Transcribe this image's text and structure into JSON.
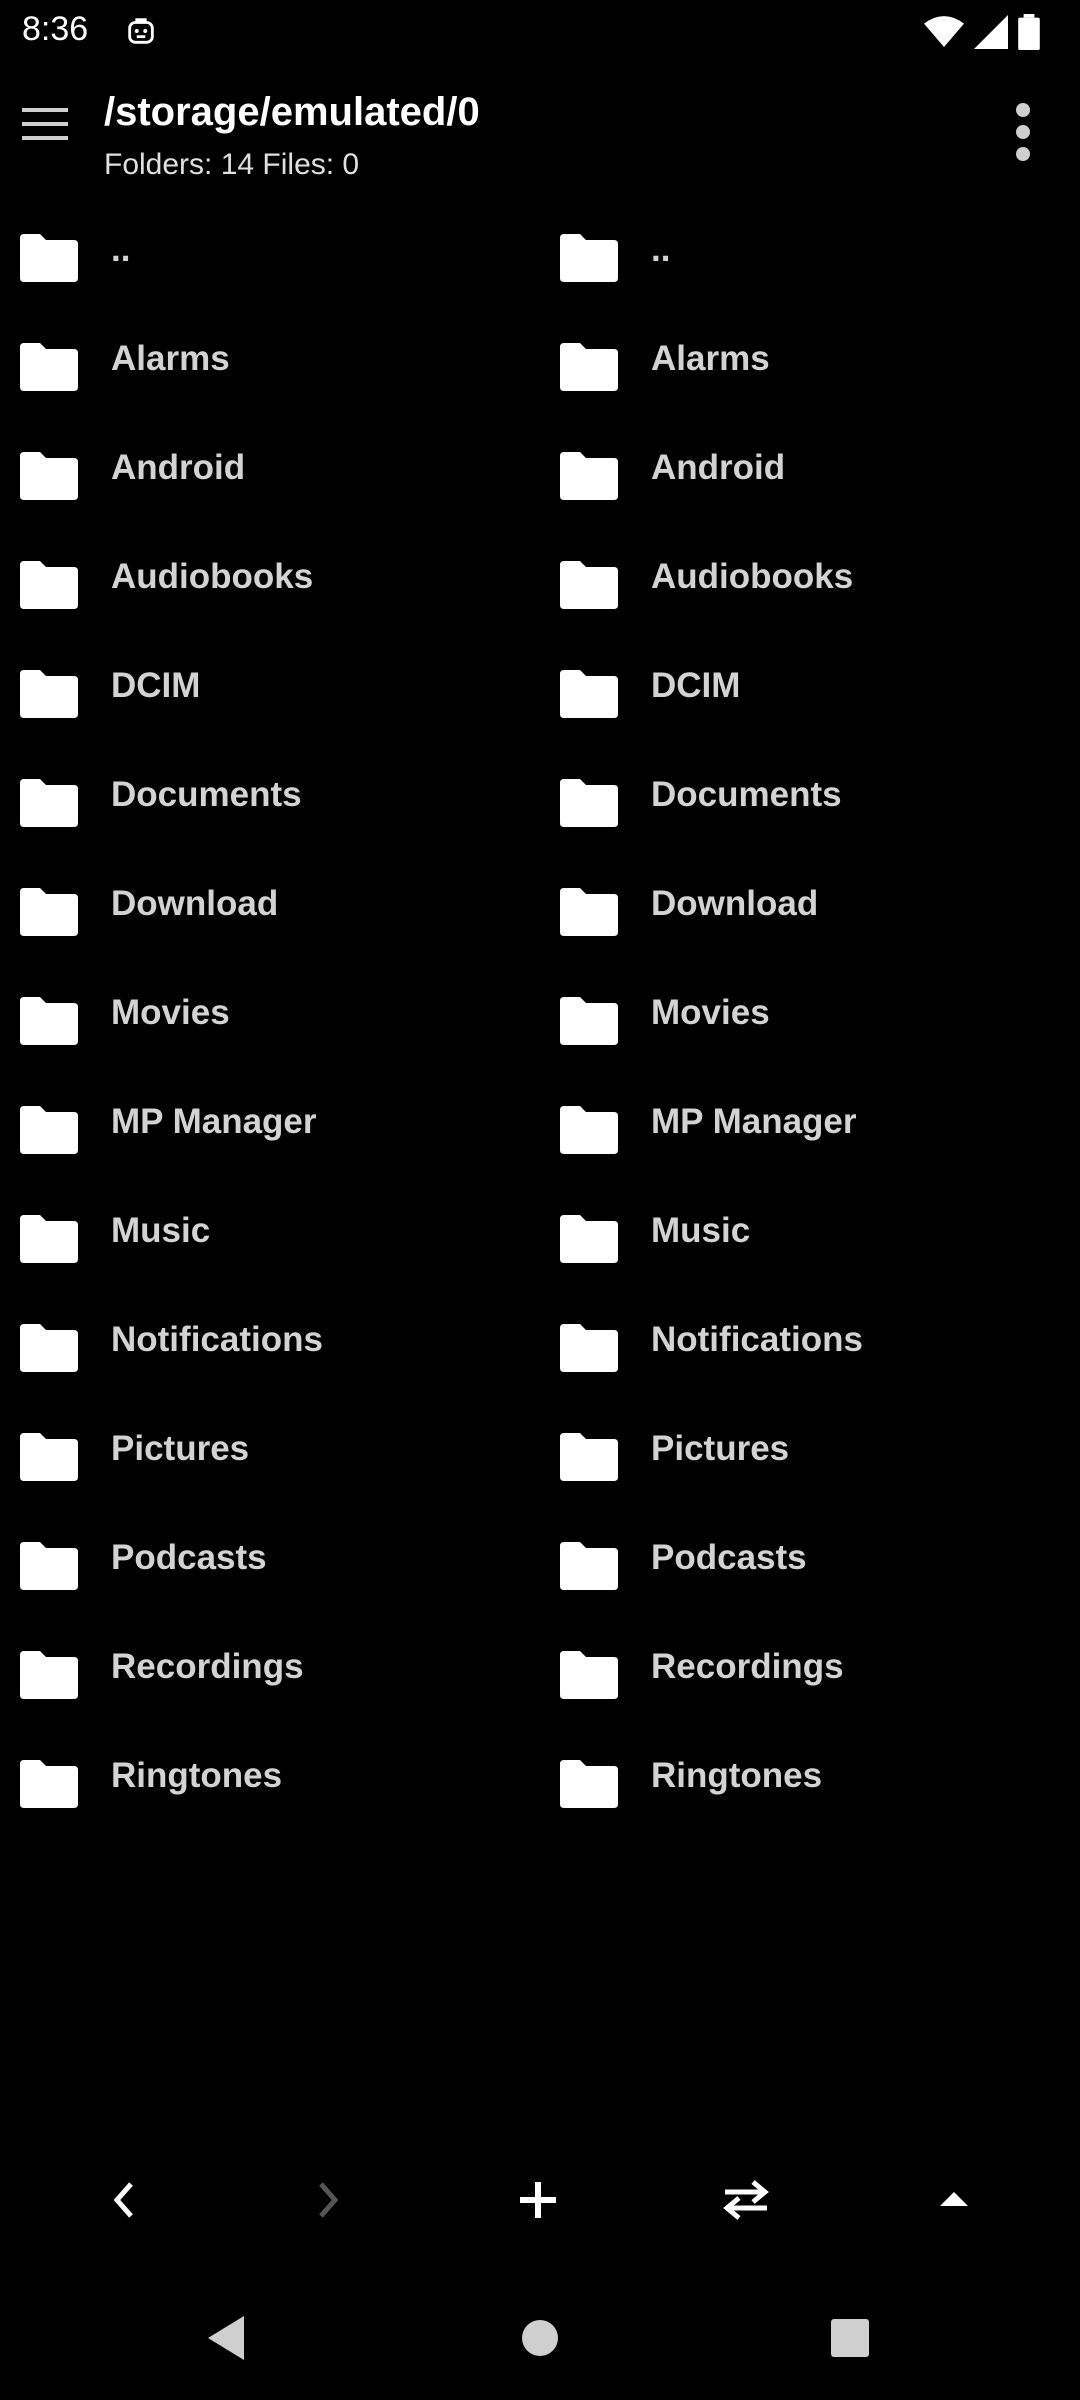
{
  "status": {
    "time": "8:36"
  },
  "header": {
    "title": "/storage/emulated/0",
    "subtitle": "Folders: 14 Files: 0"
  },
  "left_pane": {
    "items": [
      "..",
      "Alarms",
      "Android",
      "Audiobooks",
      "DCIM",
      "Documents",
      "Download",
      "Movies",
      "MP Manager",
      "Music",
      "Notifications",
      "Pictures",
      "Podcasts",
      "Recordings",
      "Ringtones"
    ]
  },
  "right_pane": {
    "items": [
      "..",
      "Alarms",
      "Android",
      "Audiobooks",
      "DCIM",
      "Documents",
      "Download",
      "Movies",
      "MP Manager",
      "Music",
      "Notifications",
      "Pictures",
      "Podcasts",
      "Recordings",
      "Ringtones"
    ]
  },
  "icons": {
    "menu": "hamburger-icon",
    "more": "more-vert-icon",
    "folder": "folder-icon",
    "back": "chevron-left-icon",
    "forward": "chevron-right-icon",
    "add": "plus-icon",
    "swap": "swap-icon",
    "up": "triangle-up-icon"
  },
  "colors": {
    "background": "#000000",
    "text": "#d6d6d6",
    "icon": "#ffffff",
    "disabled_icon": "#555555"
  }
}
